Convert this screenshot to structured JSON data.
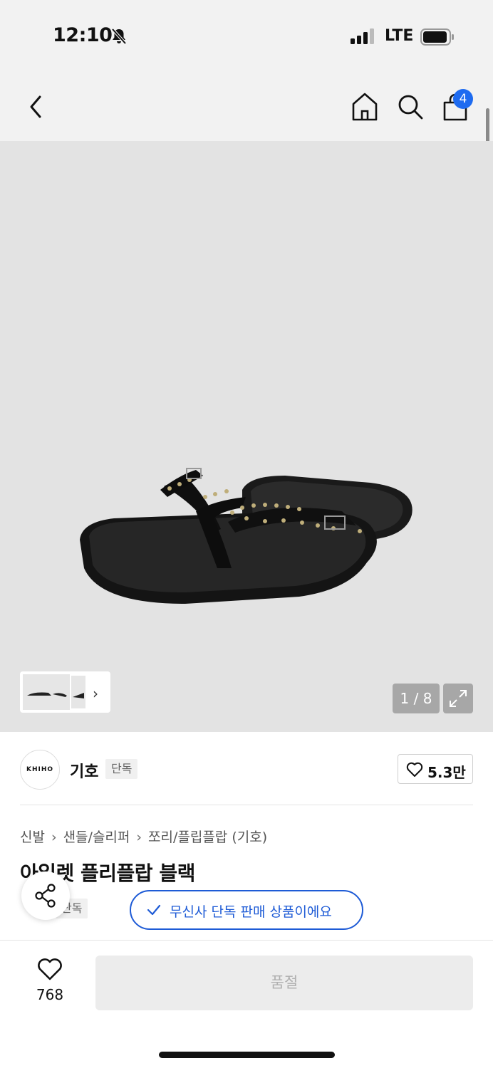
{
  "status_bar": {
    "time": "12:10",
    "network": "LTE"
  },
  "nav": {
    "bag_count": "4"
  },
  "gallery": {
    "counter": "1 / 8"
  },
  "brand": {
    "logo_text": "KHIHO",
    "name": "기호",
    "tag": "단독",
    "like_count": "5.3만"
  },
  "breadcrumb": [
    "신발",
    "샌들/슬리퍼",
    "쪼리/플립플랍 (기호)"
  ],
  "product": {
    "title": "아일렛 플리플랍 블랙",
    "tag": "단독",
    "exclusive_message": "무신사 단독 판매 상품이에요"
  },
  "bottom": {
    "wish_count": "768",
    "buy_label": "품절"
  },
  "colors": {
    "accent": "#1e5bd6",
    "badge": "#1e6bf0",
    "background": "#f2f2f2",
    "image_bg": "#e3e3e3"
  }
}
